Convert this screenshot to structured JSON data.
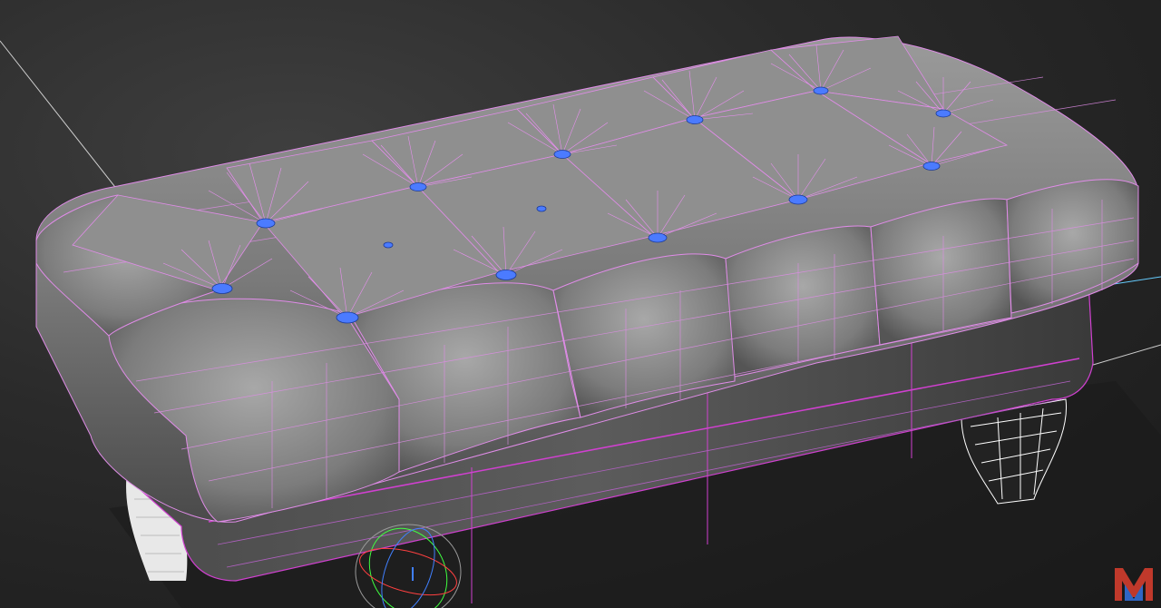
{
  "viewport": {
    "mode": "3d-perspective",
    "shading": "smooth-with-edged-faces",
    "background_color": "#2a2a2a"
  },
  "scene": {
    "object": "tufted-ottoman",
    "mesh_color": "#8c8c8c",
    "wire_color": "#e08ce8",
    "selection_color": "#d040d0",
    "button_color": "#4b7bff",
    "leg_wire_color": "#ffffff",
    "guide_line_color": "#66ccff",
    "tuft_rows": 3,
    "tuft_columns": 6
  },
  "gizmo": {
    "icon": "view-orientation-gizmo",
    "axis_colors": [
      "#ff4040",
      "#40ff40",
      "#4080ff"
    ]
  },
  "watermark": {
    "icon": "m-logo-icon",
    "letter": "M",
    "color": "#c0392b"
  }
}
